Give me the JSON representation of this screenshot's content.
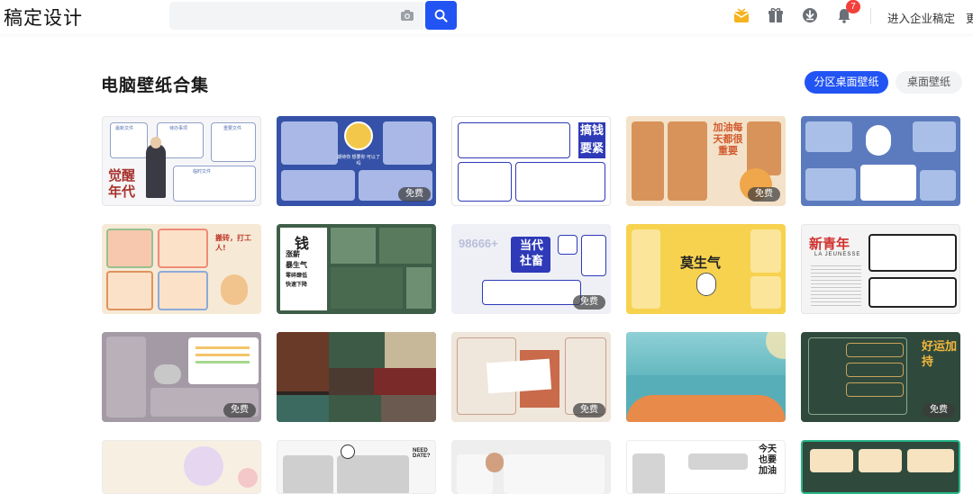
{
  "header": {
    "logo": "稿定设计",
    "search": {
      "placeholder": ""
    },
    "notification_count": "7",
    "enterprise_link": "进入企业稿定",
    "more_link": "更",
    "icons": [
      "vip-crown-icon",
      "gift-icon",
      "download-icon",
      "bell-icon",
      "camera-icon",
      "search-icon"
    ]
  },
  "section": {
    "title": "电脑壁纸合集",
    "tabs": [
      {
        "label": "分区桌面壁纸",
        "active": true
      },
      {
        "label": "桌面壁纸",
        "active": false
      }
    ]
  },
  "cards": {
    "free_label": "免费",
    "c1": {
      "text": "觉醒年代",
      "labels": [
        "最新文件",
        "待办事项",
        "重要文件",
        "临时文件"
      ]
    },
    "c2": {
      "text": "期待你 想要你 可以了吗"
    },
    "c3": {
      "text": "搞钱",
      "sub": "要紧"
    },
    "c4": {
      "text": "加油每天都很重要"
    },
    "c6": {
      "text": "搬砖，打工人!"
    },
    "c7": {
      "text": "钱",
      "lines": [
        "涨薪",
        "暴生气",
        "零碎肆低",
        "快速下降"
      ]
    },
    "c8": {
      "text": "当代社畜",
      "num": "98666+"
    },
    "c9": {
      "text": "莫生气"
    },
    "c10": {
      "text": "新青年",
      "sub": "LA JEUNESSE"
    },
    "c15": {
      "text": "好运加持"
    },
    "c17": {
      "text": "NEED DATE?"
    },
    "c19": {
      "text": "今天也要加油"
    }
  },
  "colors": {
    "accent": "#2254f4",
    "badge": "#f2403b"
  }
}
